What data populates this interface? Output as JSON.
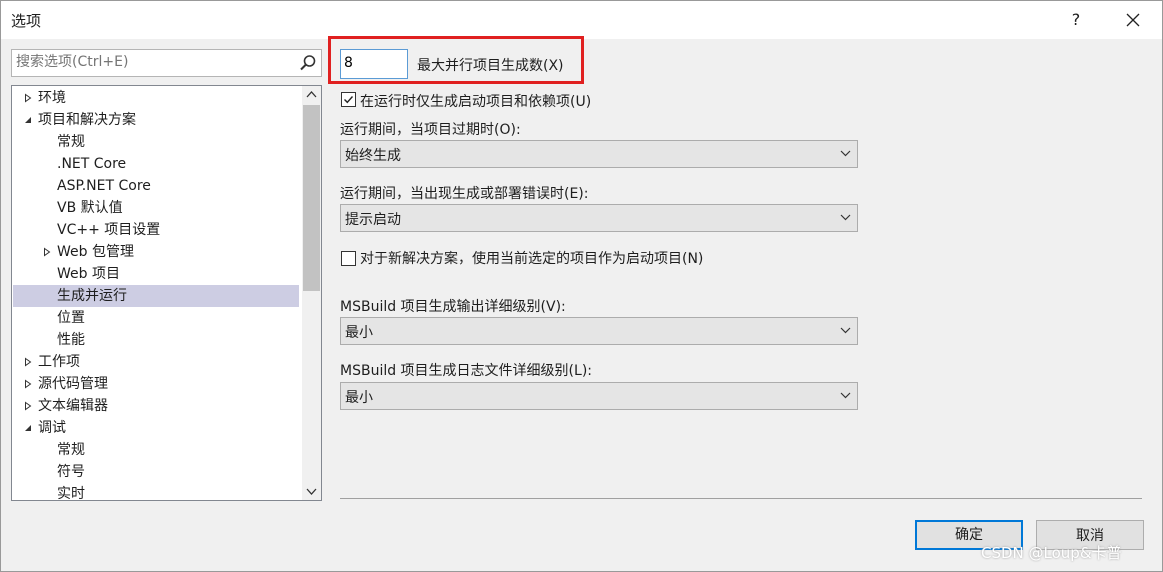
{
  "window": {
    "title": "选项",
    "help": "?"
  },
  "search": {
    "placeholder": "搜索选项(Ctrl+E)"
  },
  "tree": [
    {
      "label": "环境",
      "level": 0,
      "arrow": "right"
    },
    {
      "label": "项目和解决方案",
      "level": 0,
      "arrow": "down"
    },
    {
      "label": "常规",
      "level": 1,
      "arrow": ""
    },
    {
      "label": ".NET Core",
      "level": 1,
      "arrow": ""
    },
    {
      "label": "ASP.NET Core",
      "level": 1,
      "arrow": ""
    },
    {
      "label": "VB 默认值",
      "level": 1,
      "arrow": ""
    },
    {
      "label": "VC++ 项目设置",
      "level": 1,
      "arrow": ""
    },
    {
      "label": "Web 包管理",
      "level": 1,
      "arrow": "right"
    },
    {
      "label": "Web 项目",
      "level": 1,
      "arrow": ""
    },
    {
      "label": "生成并运行",
      "level": 1,
      "arrow": "",
      "selected": true
    },
    {
      "label": "位置",
      "level": 1,
      "arrow": ""
    },
    {
      "label": "性能",
      "level": 1,
      "arrow": ""
    },
    {
      "label": "工作项",
      "level": 0,
      "arrow": "right"
    },
    {
      "label": "源代码管理",
      "level": 0,
      "arrow": "right"
    },
    {
      "label": "文本编辑器",
      "level": 0,
      "arrow": "right"
    },
    {
      "label": "调试",
      "level": 0,
      "arrow": "down"
    },
    {
      "label": "常规",
      "level": 1,
      "arrow": ""
    },
    {
      "label": "符号",
      "level": 1,
      "arrow": ""
    },
    {
      "label": "实时",
      "level": 1,
      "arrow": ""
    }
  ],
  "settings": {
    "max_parallel_value": "8",
    "max_parallel_label": "最大并行项目生成数(X)",
    "build_startup_only_label": "在运行时仅生成启动项目和依赖项(U)",
    "build_startup_only_checked": true,
    "out_of_date_label": "运行期间，当项目过期时(O):",
    "out_of_date_value": "始终生成",
    "build_errors_label": "运行期间，当出现生成或部署错误时(E):",
    "build_errors_value": "提示启动",
    "new_solution_label": "对于新解决方案，使用当前选定的项目作为启动项目(N)",
    "new_solution_checked": false,
    "msbuild_output_label": "MSBuild 项目生成输出详细级别(V):",
    "msbuild_output_value": "最小",
    "msbuild_log_label": "MSBuild 项目生成日志文件详细级别(L):",
    "msbuild_log_value": "最小"
  },
  "buttons": {
    "ok": "确定",
    "cancel": "取消"
  },
  "watermark": "CSDN @Loup&卡普",
  "colors": {
    "highlight": "#e02020",
    "selection": "#cdcde3",
    "accent": "#0078d7"
  }
}
